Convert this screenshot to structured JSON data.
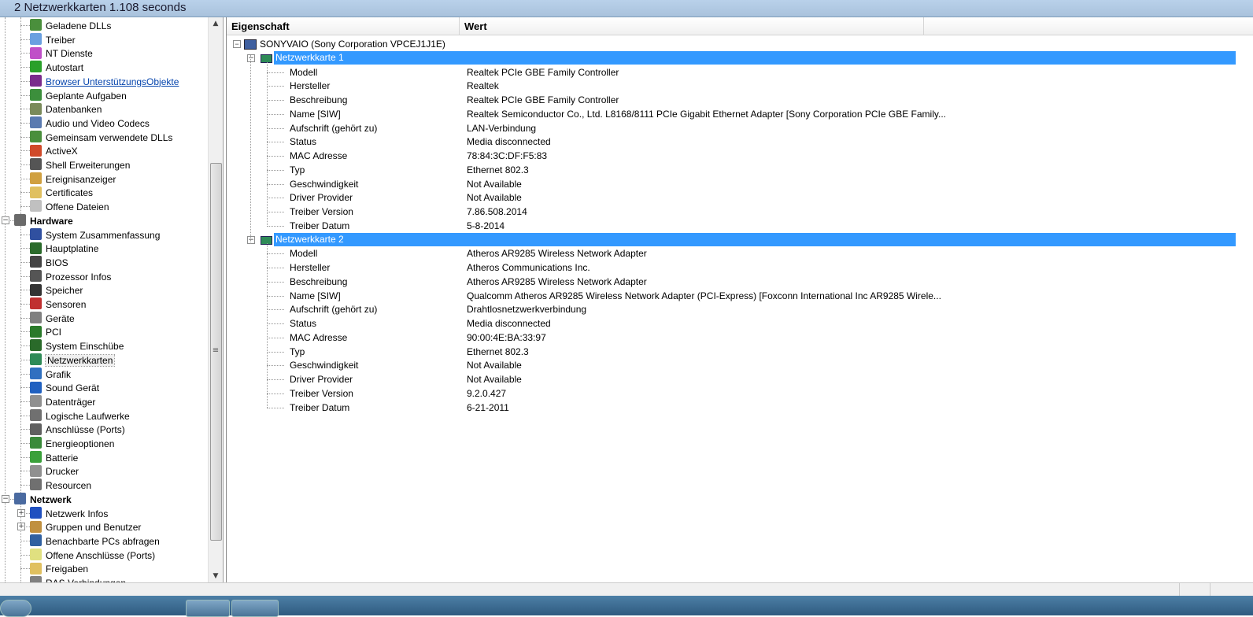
{
  "window": {
    "title": "2 Netzwerkkarten 1.108 seconds"
  },
  "tree": {
    "items": [
      {
        "label": "Geladene DLLs",
        "color": "#4a8f3c"
      },
      {
        "label": "Treiber",
        "color": "#6aa0e0"
      },
      {
        "label": "NT Dienste",
        "color": "#c04fc8"
      },
      {
        "label": "Autostart",
        "color": "#2aa02a"
      },
      {
        "label": "Browser UnterstützungsObjekte",
        "color": "#7a2c8c",
        "link": true
      },
      {
        "label": "Geplante Aufgaben",
        "color": "#3c8f3c"
      },
      {
        "label": "Datenbanken",
        "color": "#7a8a5a"
      },
      {
        "label": "Audio und Video Codecs",
        "color": "#5a7ab0"
      },
      {
        "label": "Gemeinsam verwendete DLLs",
        "color": "#4a8f3c"
      },
      {
        "label": "ActiveX",
        "color": "#d04a2a"
      },
      {
        "label": "Shell Erweiterungen",
        "color": "#555555"
      },
      {
        "label": "Ereignisanzeiger",
        "color": "#d0a040"
      },
      {
        "label": "Certificates",
        "color": "#e0c060"
      },
      {
        "label": "Offene Dateien",
        "color": "#c0c0c0"
      },
      {
        "label": "Hardware",
        "color": "#6a6a6a",
        "category": true
      },
      {
        "label": "System Zusammenfassung",
        "color": "#3050a0"
      },
      {
        "label": "Hauptplatine",
        "color": "#2a6a2a"
      },
      {
        "label": "BIOS",
        "color": "#444444"
      },
      {
        "label": "Prozessor Infos",
        "color": "#555555"
      },
      {
        "label": "Speicher",
        "color": "#333333"
      },
      {
        "label": "Sensoren",
        "color": "#c03030"
      },
      {
        "label": "Geräte",
        "color": "#808080"
      },
      {
        "label": "PCI",
        "color": "#2a7a2a"
      },
      {
        "label": "System Einschübe",
        "color": "#2a6a2a"
      },
      {
        "label": "Netzwerkkarten",
        "color": "#2e8b57",
        "selected": true
      },
      {
        "label": "Grafik",
        "color": "#3070c0"
      },
      {
        "label": "Sound Gerät",
        "color": "#2060c0"
      },
      {
        "label": "Datenträger",
        "color": "#909090"
      },
      {
        "label": "Logische Laufwerke",
        "color": "#707070"
      },
      {
        "label": "Anschlüsse (Ports)",
        "color": "#606060"
      },
      {
        "label": "Energieoptionen",
        "color": "#3a8a3a"
      },
      {
        "label": "Batterie",
        "color": "#3aa03a"
      },
      {
        "label": "Drucker",
        "color": "#909090"
      },
      {
        "label": "Resourcen",
        "color": "#707070"
      },
      {
        "label": "Netzwerk",
        "color": "#4a6aa0",
        "category": true
      },
      {
        "label": "Netzwerk Infos",
        "color": "#2050c0"
      },
      {
        "label": "Gruppen und Benutzer",
        "color": "#c09040"
      },
      {
        "label": "Benachbarte PCs abfragen",
        "color": "#3060a0"
      },
      {
        "label": "Offene Anschlüsse (Ports)",
        "color": "#e0e080"
      },
      {
        "label": "Freigaben",
        "color": "#e0c060"
      },
      {
        "label": "RAS Verbindungen",
        "color": "#808080"
      }
    ]
  },
  "details": {
    "columns": {
      "property": "Eigenschaft",
      "value": "Wert"
    },
    "root": "SONYVAIO (Sony Corporation VPCEJ1J1E)",
    "cards": [
      {
        "name": "Netzwerkkarte 1",
        "rows": [
          {
            "prop": "Modell",
            "val": "Realtek PCIe GBE Family Controller"
          },
          {
            "prop": "Hersteller",
            "val": "Realtek"
          },
          {
            "prop": "Beschreibung",
            "val": "Realtek PCIe GBE Family Controller"
          },
          {
            "prop": "Name [SIW]",
            "val": "Realtek Semiconductor Co., Ltd. L8168/8111 PCIe Gigabit Ethernet Adapter [Sony Corporation PCIe GBE Family..."
          },
          {
            "prop": "Aufschrift (gehört zu)",
            "val": "LAN-Verbindung"
          },
          {
            "prop": "Status",
            "val": "Media disconnected"
          },
          {
            "prop": "MAC Adresse",
            "val": "78:84:3C:DF:F5:83"
          },
          {
            "prop": "Typ",
            "val": "Ethernet 802.3"
          },
          {
            "prop": "Geschwindigkeit",
            "val": "Not Available"
          },
          {
            "prop": "Driver Provider",
            "val": "Not Available"
          },
          {
            "prop": "Treiber Version",
            "val": "7.86.508.2014"
          },
          {
            "prop": "Treiber Datum",
            "val": "5-8-2014"
          }
        ]
      },
      {
        "name": "Netzwerkkarte 2",
        "rows": [
          {
            "prop": "Modell",
            "val": "Atheros AR9285 Wireless Network Adapter"
          },
          {
            "prop": "Hersteller",
            "val": "Atheros Communications Inc."
          },
          {
            "prop": "Beschreibung",
            "val": "Atheros AR9285 Wireless Network Adapter"
          },
          {
            "prop": "Name [SIW]",
            "val": "Qualcomm Atheros AR9285 Wireless Network Adapter (PCI-Express) [Foxconn International Inc AR9285 Wirele..."
          },
          {
            "prop": "Aufschrift (gehört zu)",
            "val": "Drahtlosnetzwerkverbindung"
          },
          {
            "prop": "Status",
            "val": "Media disconnected"
          },
          {
            "prop": "MAC Adresse",
            "val": "90:00:4E:BA:33:97"
          },
          {
            "prop": "Typ",
            "val": "Ethernet 802.3"
          },
          {
            "prop": "Geschwindigkeit",
            "val": "Not Available"
          },
          {
            "prop": "Driver Provider",
            "val": "Not Available"
          },
          {
            "prop": "Treiber Version",
            "val": "9.2.0.427"
          },
          {
            "prop": "Treiber Datum",
            "val": "6-21-2011"
          }
        ]
      }
    ]
  },
  "colors": {
    "selection": "#3399ff",
    "link": "#0645ad"
  }
}
